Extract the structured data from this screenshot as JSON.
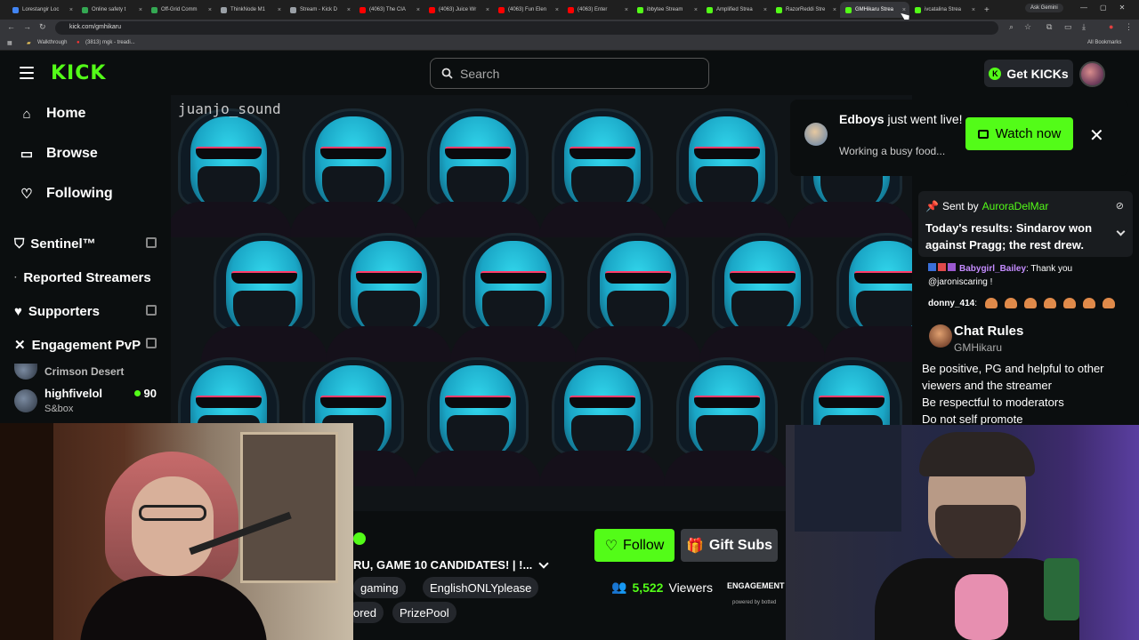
{
  "browser": {
    "tabs": [
      {
        "label": "Lorestangir Loc",
        "color": "#4285f4"
      },
      {
        "label": "Online safety t",
        "color": "#34a853"
      },
      {
        "label": "Off-Grid Comm",
        "color": "#34a853"
      },
      {
        "label": "ThinkNode M1",
        "color": "#9aa0a6"
      },
      {
        "label": "Stream - Kick D",
        "color": "#9aa0a6"
      },
      {
        "label": "(4063) The CIA",
        "color": "#ff0000"
      },
      {
        "label": "(4063) Juice Wr",
        "color": "#ff0000"
      },
      {
        "label": "(4063) Fun Elen",
        "color": "#ff0000"
      },
      {
        "label": "(4063) Enter",
        "color": "#ff0000"
      },
      {
        "label": "ibbytee Stream",
        "color": "#53fc18"
      },
      {
        "label": "Amplified Strea",
        "color": "#53fc18"
      },
      {
        "label": "RazorReddi Stre",
        "color": "#53fc18"
      },
      {
        "label": "GMHikaru Strea",
        "color": "#53fc18"
      },
      {
        "label": "ivcatalina Strea",
        "color": "#53fc18"
      }
    ],
    "gemini_label": "Ask Gemini",
    "url": "kick.com/gmhikaru",
    "bookmarks": [
      "Walkthrough",
      "(3813) mgk - treadi..."
    ],
    "all_bookmarks": "All Bookmarks"
  },
  "header": {
    "logo": "KICK",
    "search_placeholder": "Search",
    "get_kicks": "Get KICKs"
  },
  "sidebar": {
    "nav": [
      {
        "label": "Home",
        "icon": "home-icon"
      },
      {
        "label": "Browse",
        "icon": "browse-icon"
      },
      {
        "label": "Following",
        "icon": "heart-icon"
      }
    ],
    "sections": [
      {
        "label": "Sentinel™",
        "icon": "shield-icon"
      },
      {
        "label": "Reported Streamers"
      },
      {
        "label": "Supporters",
        "icon": "heart-icon"
      },
      {
        "label": "Engagement PvP",
        "icon": "swords-icon"
      }
    ],
    "channels": [
      {
        "name": "Crimson Desert",
        "category": ""
      },
      {
        "name": "highfivelol",
        "category": "S&box",
        "viewers": "90"
      }
    ]
  },
  "video": {
    "watermark": "juanjo_sound"
  },
  "notification": {
    "streamer": "Edboys",
    "text": "just went live!",
    "subtitle": "Working a busy food...",
    "button": "Watch now"
  },
  "chat": {
    "pinned_prefix": "Sent by",
    "pinned_user": "AuroraDelMar",
    "pinned_message": "Today's results: Sindarov won against Pragg; the rest drew.",
    "messages": [
      {
        "user": "Babygirl_Bailey",
        "text": ": Thank you @jaroniscaring !",
        "color": "#c58cff"
      },
      {
        "user": "donny_414",
        "text": ":",
        "color": "#ffffff"
      }
    ],
    "rules_title": "Chat Rules",
    "rules_owner": "GMHikaru",
    "rules": [
      "Be positive, PG and helpful to other viewers and the streamer",
      "Be respectful to moderators",
      "Do not self promote"
    ]
  },
  "stream": {
    "title": "RU, GAME 10 CANDIDATES! | !...",
    "tags": [
      "gaming",
      "EnglishONLYplease",
      "ored",
      "PrizePool"
    ],
    "follow": "Follow",
    "gift": "Gift Subs",
    "viewers_count": "5,522",
    "viewers_label": "Viewers",
    "engagement": "ENGAGEMENT",
    "powered": "powered by botted"
  },
  "colors": {
    "accent": "#53fc18",
    "background": "#0b0e0f"
  }
}
